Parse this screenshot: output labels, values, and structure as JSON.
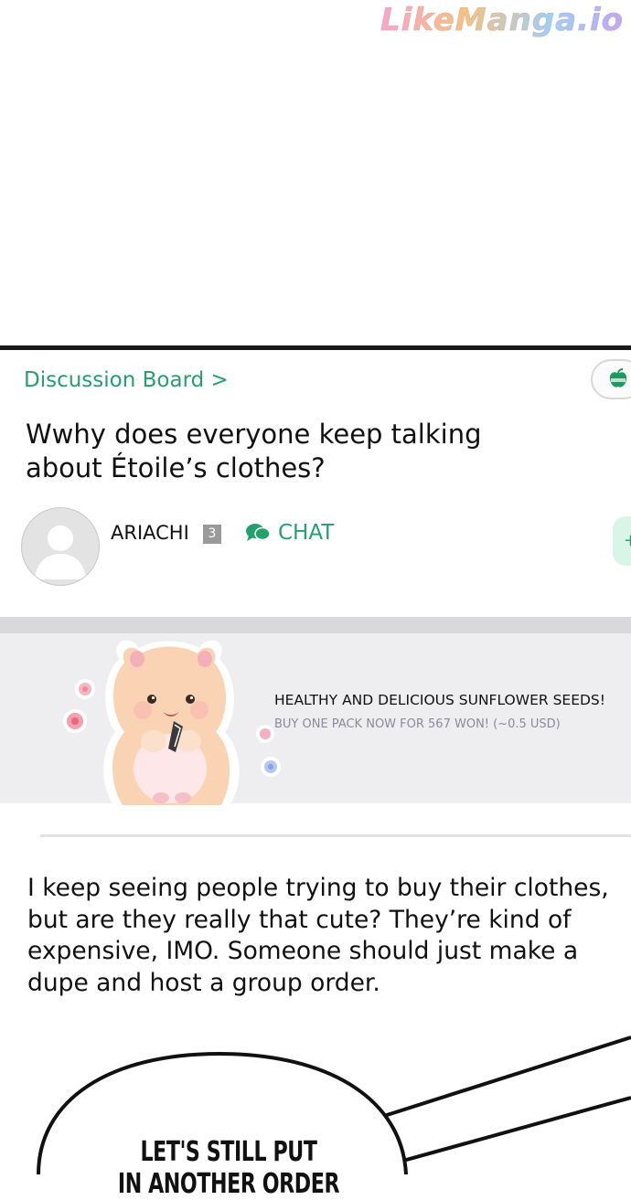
{
  "watermark": {
    "text": "LikeManga.io"
  },
  "header": {
    "breadcrumb": "Discussion Board >",
    "title": "Wwhy does everyone keep talking about Étoile’s clothes?"
  },
  "author": {
    "username": "ARIACHI",
    "level": "3",
    "chat_label": "CHAT"
  },
  "ad": {
    "headline": "HEALTHY AND DELICIOUS SUNFLOWER SEEDS!",
    "subtext": "BUY ONE PACK NOW FOR 567 WON! (~0.5 USD)"
  },
  "post": {
    "body": "I keep seeing people trying to buy their clothes, but are they really that cute? They’re kind of expensive, IMO. Someone should just make a dupe and host a group order."
  },
  "speech_bubble": {
    "line1": "LET'S STILL PUT",
    "line2": "IN ANOTHER ORDER"
  },
  "colors": {
    "accent": "#23a06b",
    "ad_background": "#eeeef0",
    "text": "#111111"
  },
  "icons": {
    "top_badge": "apple-icon",
    "chat": "chat-bubbles-icon",
    "avatar": "default-avatar-icon"
  }
}
